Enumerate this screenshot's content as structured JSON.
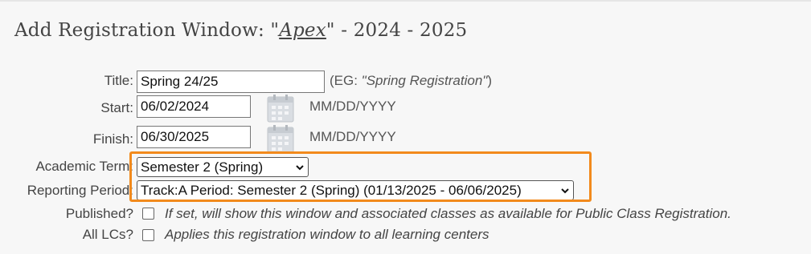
{
  "header": {
    "title_prefix": "Add Registration Window: \"",
    "course_name": "Apex",
    "title_suffix": "\" - 2024 - 2025"
  },
  "form": {
    "title": {
      "label": "Title:",
      "value": "Spring 24/25",
      "hint_prefix": "(EG: ",
      "hint_example": "\"Spring Registration\"",
      "hint_suffix": ")"
    },
    "start": {
      "label": "Start:",
      "value": "06/02/2024",
      "format_hint": "MM/DD/YYYY",
      "icon": "calendar-icon"
    },
    "finish": {
      "label": "Finish:",
      "value": "06/30/2025",
      "format_hint": "MM/DD/YYYY",
      "icon": "calendar-icon"
    },
    "academic_term": {
      "label": "Academic Term:",
      "selected": "Semester 2 (Spring)"
    },
    "reporting_period": {
      "label": "Reporting Period:",
      "selected": "Track:A Period: Semester 2 (Spring) (01/13/2025 - 06/06/2025)"
    },
    "published": {
      "label": "Published?",
      "checked": false,
      "description": "If set, will show this window and associated classes as available for Public Class Registration."
    },
    "all_lcs": {
      "label": "All LCs?",
      "checked": false,
      "description": "Applies this registration window to all learning centers"
    }
  },
  "colors": {
    "highlight": "#f28a1c",
    "background": "#f7f7f7"
  }
}
